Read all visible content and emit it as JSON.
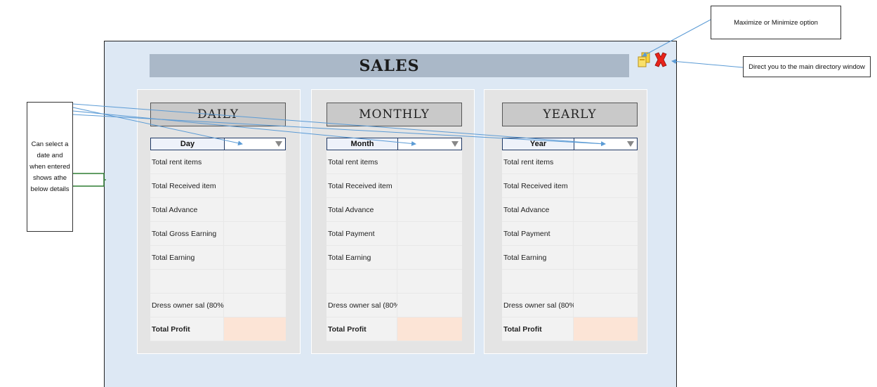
{
  "window": {
    "title": "SALES"
  },
  "controls": {
    "restore_icon": "restore-window-icon",
    "close_icon": "close-x-icon",
    "close_color": "#e8231a"
  },
  "panels": [
    {
      "title": "DAILY",
      "select_label": "Day",
      "rows": [
        {
          "label": "Total rent items",
          "value": ""
        },
        {
          "label": "Total Received item",
          "value": ""
        },
        {
          "label": "Total Advance",
          "value": ""
        },
        {
          "label": "Total Gross Earning",
          "value": ""
        },
        {
          "label": "Total Earning",
          "value": ""
        },
        {
          "label": "",
          "value": ""
        },
        {
          "label": "Dress owner sal (80%)",
          "value": ""
        },
        {
          "label": "Total Profit",
          "value": ""
        }
      ]
    },
    {
      "title": "MONTHLY",
      "select_label": "Month",
      "rows": [
        {
          "label": "Total rent items",
          "value": ""
        },
        {
          "label": "Total Received item",
          "value": ""
        },
        {
          "label": "Total Advance",
          "value": ""
        },
        {
          "label": "Total Payment",
          "value": ""
        },
        {
          "label": "Total Earning",
          "value": ""
        },
        {
          "label": "",
          "value": ""
        },
        {
          "label": "Dress owner sal (80%)",
          "value": ""
        },
        {
          "label": "Total Profit",
          "value": ""
        }
      ]
    },
    {
      "title": "YEARLY",
      "select_label": "Year",
      "rows": [
        {
          "label": "Total rent items",
          "value": ""
        },
        {
          "label": "Total Received item",
          "value": ""
        },
        {
          "label": "Total Advance",
          "value": ""
        },
        {
          "label": "Total Payment",
          "value": ""
        },
        {
          "label": "Total Earning",
          "value": ""
        },
        {
          "label": "",
          "value": ""
        },
        {
          "label": "Dress owner sal (80%)",
          "value": ""
        },
        {
          "label": "Total Profit",
          "value": ""
        }
      ]
    }
  ],
  "annotations": {
    "select_note": "Can select a date and when entered shows athe below details",
    "maximize_note": "Maximize or Minimize option",
    "directory_note": "Direct you to the main directory window"
  },
  "colors": {
    "window_bg": "#dde8f4",
    "title_bar": "#aab8c8",
    "panel_bg": "#e4e4e4",
    "profit_cell": "#fce4d6",
    "arrow": "#5b9bd5",
    "bracket": "#2e7d32"
  }
}
